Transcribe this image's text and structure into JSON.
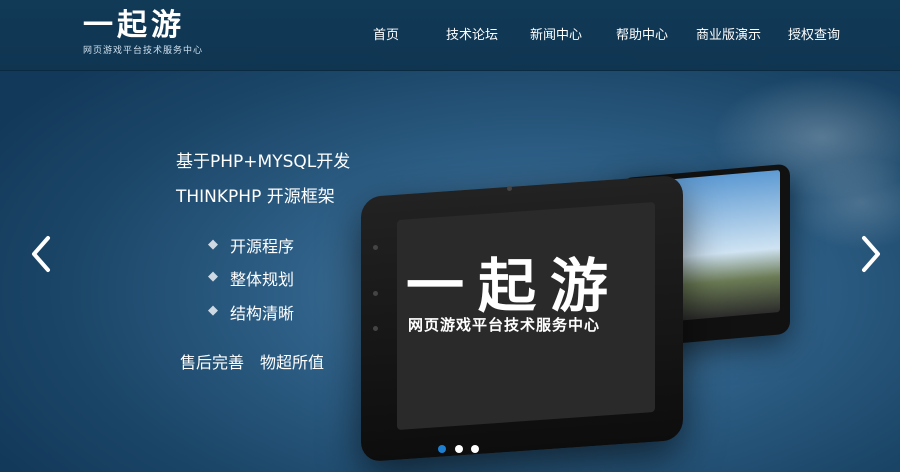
{
  "header": {
    "logo": {
      "title": "一起游",
      "subtitle": "网页游戏平台技术服务中心"
    },
    "nav": [
      {
        "label": "首页"
      },
      {
        "label": "技术论坛"
      },
      {
        "label": "新闻中心"
      },
      {
        "label": "帮助中心"
      },
      {
        "label": "商业版演示"
      },
      {
        "label": "授权查询"
      }
    ]
  },
  "banner": {
    "headline1": "基于PHP+MYSQL开发",
    "headline2": "THINKPHP 开源框架",
    "features": [
      "开源程序",
      "整体规划",
      "结构清晰"
    ],
    "bullet_glyph": "◆",
    "tagline": "售后完善　物超所值",
    "screen_title": "一起游",
    "screen_subtitle": "网页游戏平台技术服务中心",
    "active_slide": 1,
    "slide_count": 3
  },
  "colors": {
    "header_bg": "#113a57",
    "banner_bg": "#2e5f86",
    "active_dot": "#1e7fd1",
    "inactive_dot": "#ffffff"
  },
  "icons": {
    "prev": "chevron-left-icon",
    "next": "chevron-right-icon"
  }
}
